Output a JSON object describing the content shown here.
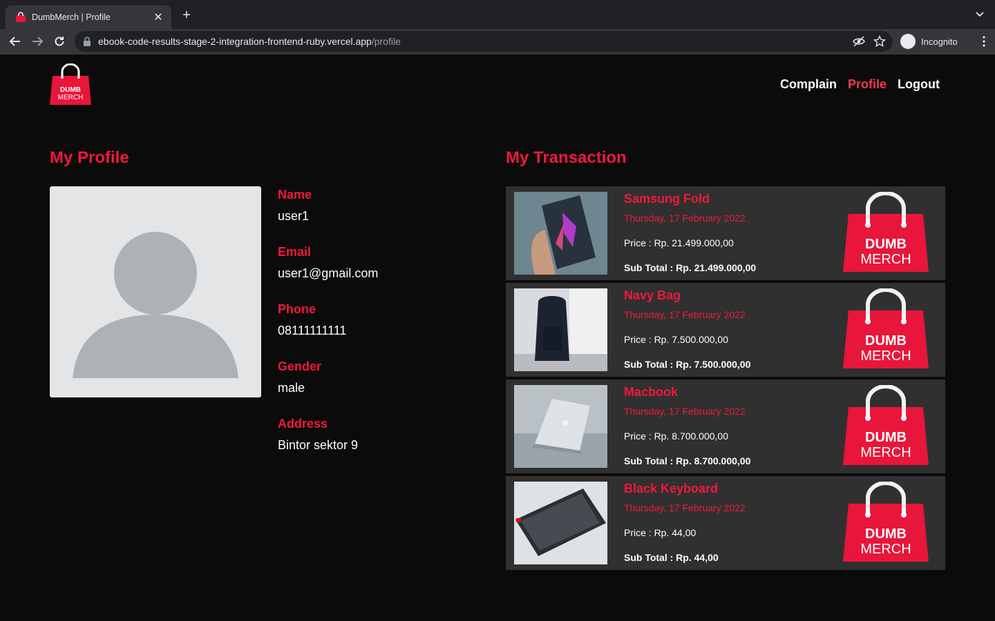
{
  "browser": {
    "tab_title": "DumbMerch | Profile",
    "url_host": "ebook-code-results-stage-2-integration-frontend-ruby.vercel.app",
    "url_path": "/profile",
    "incognito_label": "Incognito"
  },
  "header": {
    "logo_text_top": "DUMB",
    "logo_text_bottom": "MERCH",
    "nav": [
      {
        "label": "Complain",
        "active": false
      },
      {
        "label": "Profile",
        "active": true
      },
      {
        "label": "Logout",
        "active": false
      }
    ]
  },
  "profile": {
    "title": "My Profile",
    "fields": [
      {
        "label": "Name",
        "value": "user1"
      },
      {
        "label": "Email",
        "value": "user1@gmail.com"
      },
      {
        "label": "Phone",
        "value": "08111111111"
      },
      {
        "label": "Gender",
        "value": "male"
      },
      {
        "label": "Address",
        "value": "Bintor sektor 9"
      }
    ]
  },
  "transactions": {
    "title": "My Transaction",
    "items": [
      {
        "name": "Samsung Fold",
        "date": "Thursday, 17 February 2022",
        "price": "Price : Rp. 21.499.000,00",
        "subtotal": "Sub Total : Rp. 21.499.000,00",
        "image": "phone-image"
      },
      {
        "name": "Navy Bag",
        "date": "Thursday, 17 February 2022",
        "price": "Price : Rp. 7.500.000,00",
        "subtotal": "Sub Total : Rp. 7.500.000,00",
        "image": "backpack-image"
      },
      {
        "name": "Macbook",
        "date": "Thursday, 17 February 2022",
        "price": "Price : Rp. 8.700.000,00",
        "subtotal": "Sub Total : Rp. 8.700.000,00",
        "image": "laptop-image"
      },
      {
        "name": "Black Keyboard",
        "date": "Thursday, 17 February 2022",
        "price": "Price : Rp. 44,00",
        "subtotal": "Sub Total : Rp. 44,00",
        "image": "keyboard-image"
      }
    ]
  },
  "colors": {
    "accent": "#f2183e",
    "card_bg": "#303030",
    "page_bg": "#0b0b0b"
  }
}
